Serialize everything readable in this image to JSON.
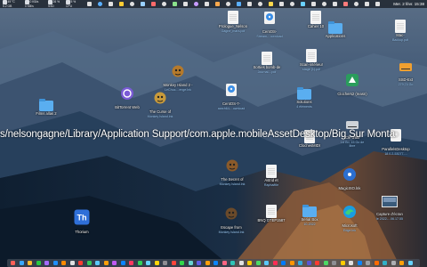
{
  "menubar": {
    "stats": [
      {
        "text": "49 °C",
        "sub": "5.2 GB"
      },
      {
        "text": "0 KB/s",
        "sub": "0 KB/s"
      },
      {
        "text": "26 %",
        "sub": "SSD"
      },
      {
        "text": "5 %",
        "sub": "CPU"
      }
    ],
    "time": "Mer. 2 févr. 15:38",
    "icon_colors": [
      "#e0e0e0",
      "#5ab0ff",
      "#e0e0e0",
      "#ffcc33",
      "#e0e0e0",
      "#9ad0ff",
      "#ff6a6a",
      "#e0e0e0",
      "#8be28b",
      "#e0e0e0",
      "#c79bff",
      "#e0e0e0",
      "#ffa94d",
      "#e0e0e0",
      "#5ab0ff",
      "#e0e0e0",
      "#e0e0e0",
      "#ffd84d",
      "#e0e0e0",
      "#e0e0e0",
      "#6ad1ff",
      "#e0e0e0",
      "#e0e0e0",
      "#e0e0e0",
      "#ff7b7b",
      "#e0e0e0",
      "#e0e0e0",
      "#e0e0e0"
    ]
  },
  "overlay_text": "s/nelsongagne/Library/Application Support/com.apple.mobileAssetDesktop/Big Sur Monta",
  "desktop": [
    {
      "name": "film-folder",
      "label": "Films allas 2",
      "sub": "",
      "icon": "folder-icon",
      "color": "#5aaef0"
    },
    {
      "name": "bittorrent",
      "label": "BitTorrent Web",
      "sub": "",
      "icon": "bittorrent-icon",
      "color": "#7a5bd6"
    },
    {
      "name": "monkey-island-2",
      "label": "Monkey Island 2 -",
      "sub": "LeChuc....enge.lnk",
      "icon": "monkey-island-icon",
      "color": "#b57a2c"
    },
    {
      "name": "curse-monkey-island",
      "label": "The Curse of",
      "sub": "Monkey Island.lnk",
      "icon": "monkey-island-icon",
      "color": "#c89a3b"
    },
    {
      "name": "prologue-file",
      "label": "Prologue_Nelson",
      "sub": "Gagne_mars.pdf",
      "icon": "document-icon",
      "color": "#f4f4f4"
    },
    {
      "name": "centos-stream",
      "label": "CentOS-",
      "sub": "Stream-...ownload",
      "icon": "disk-image-icon",
      "color": "#3a8ee6"
    },
    {
      "name": "cahier-notes",
      "label": "Cahier 10",
      "sub": "",
      "icon": "document-icon",
      "color": "#f4f4f4"
    },
    {
      "name": "applications-folder",
      "label": "Applications",
      "sub": "",
      "icon": "folder-icon",
      "color": "#5aaef0"
    },
    {
      "name": "mac-folder",
      "label": "Mac-",
      "sub": "Backup.pdf",
      "icon": "document-icon",
      "color": "#f4f4f4"
    },
    {
      "name": "ssd-drive",
      "label": "SSD-Ext",
      "sub": "279,74 Go",
      "icon": "drive-icon",
      "color": "#f0a030"
    },
    {
      "name": "sorties-file",
      "label": "Sorties bomb-de",
      "sub": "Journal....pdf",
      "icon": "document-icon",
      "color": "#f4f4f4"
    },
    {
      "name": "scan-file",
      "label": "Scan-intérieur",
      "sub": "stage (1).pdf",
      "icon": "document-icon",
      "color": "#f4f4f4"
    },
    {
      "name": "centos-7",
      "label": "CentOS-7-",
      "sub": "aarch64-...ownload",
      "icon": "disk-image-icon",
      "color": "#3a8ee6"
    },
    {
      "name": "solutions-folder",
      "label": "Solutions",
      "sub": "4 éléments",
      "icon": "folder-icon",
      "color": "#5aaef0"
    },
    {
      "name": "clochers-file",
      "label": "Clochers2 (reasn)",
      "sub": "",
      "icon": "app-icon",
      "color": "#2a9d5c"
    },
    {
      "name": "cle-usb",
      "label": "Clé USB",
      "sub": "16 Go, 15 Go de libre",
      "icon": "drive-icon",
      "color": "#cfd3d8"
    },
    {
      "name": "parallels",
      "label": "ParallelsDesktop",
      "sub": "18.0.2-53077-...",
      "icon": "disk-image-icon",
      "color": "#dcdcdc"
    },
    {
      "name": "cloches-midi",
      "label": "ClochesMIDI",
      "sub": "",
      "icon": "document-icon",
      "color": "#f4f4f4"
    },
    {
      "name": "secret-monkey-island",
      "label": "The Secret of",
      "sub": "Monkey Island.lnk",
      "icon": "monkey-island-icon",
      "color": "#8a5a2a"
    },
    {
      "name": "astrid-raphaelle",
      "label": "Astrid et",
      "sub": "Raphaëlle",
      "icon": "document-icon",
      "color": "#f4f4f4"
    },
    {
      "name": "magiciso",
      "label": "MagicISO.lnk",
      "sub": "",
      "icon": "magiciso-icon",
      "color": "#2c6fd0"
    },
    {
      "name": "escape-monkey-island",
      "label": "Escape from",
      "sub": "Monkey Island.lnk",
      "icon": "monkey-island-icon",
      "color": "#6b4a2a"
    },
    {
      "name": "bnq-file",
      "label": "BNQ OTEP1587",
      "sub": "",
      "icon": "document-icon",
      "color": "#f4f4f4"
    },
    {
      "name": "serial-box",
      "label": "Serial Box",
      "sub": "10-2022",
      "icon": "folder-icon",
      "color": "#5aaef0"
    },
    {
      "name": "microsoft-edge",
      "label": "Microsoft",
      "sub": "Edge.lnk",
      "icon": "edge-icon",
      "color": "#1a9de0"
    },
    {
      "name": "capture-ecran",
      "label": "Capture d'écran",
      "sub": "le 2022-...06.17.55",
      "icon": "screenshot-icon",
      "color": "#3a5a7a"
    },
    {
      "name": "thorium",
      "label": "Thorium",
      "sub": "",
      "icon": "thorium-icon",
      "color": "#2f6fd8"
    }
  ],
  "dock_colors": [
    "#ff5f57",
    "#38a7ff",
    "#ffbd2e",
    "#28c840",
    "#a36bff",
    "#1f8fff",
    "#ff8a00",
    "#e0e0e0",
    "#ff3b30",
    "#34c759",
    "#5ac8fa",
    "#ff9f0a",
    "#bf5af2",
    "#0a84ff",
    "#ff375f",
    "#30d158",
    "#64d2ff",
    "#ffd60a",
    "#8e8e93",
    "#ff453a",
    "#32d74b",
    "#66d4cf",
    "#5e5ce6",
    "#ff9f0a",
    "#0a84ff",
    "#ff6482",
    "#2ec4b6",
    "#e0e0e0",
    "#ffcc00",
    "#4cd964",
    "#5ac8fa",
    "#ff2d55",
    "#007aff",
    "#ff9500",
    "#34aadc",
    "#5856d6",
    "#ff3b30",
    "#4cd964",
    "#8e8e93",
    "#ffcc00",
    "#e0e0e0",
    "#0a84ff",
    "#9aa0a6",
    "#ff6a00",
    "#30b0c7",
    "#aeaeb2",
    "#ff9f0a",
    "#64d2ff"
  ]
}
